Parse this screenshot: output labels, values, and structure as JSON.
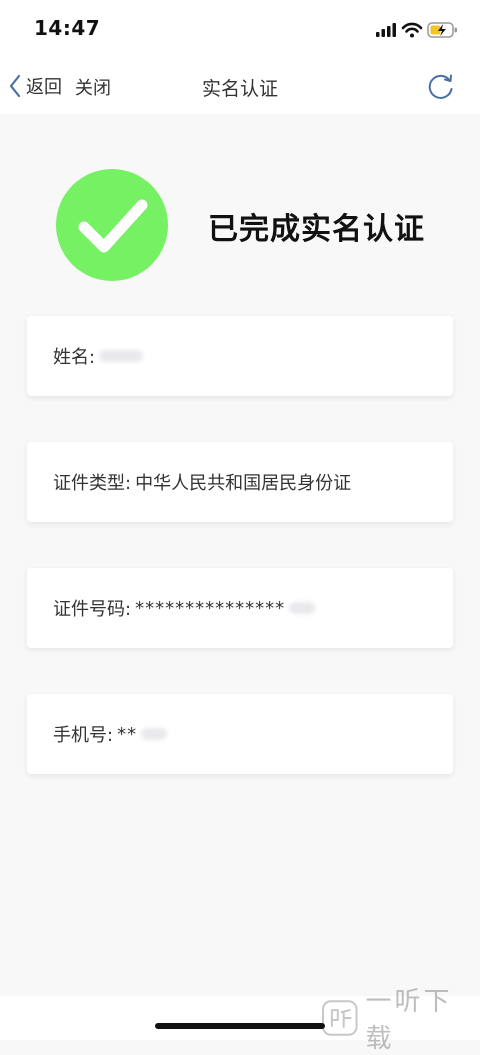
{
  "status_bar": {
    "time": "14:47",
    "icons": [
      "signal-icon",
      "wifi-icon",
      "battery-charging-icon"
    ]
  },
  "nav": {
    "back_label": "返回",
    "close_label": "关闭",
    "title": "实名认证",
    "refresh_icon": "refresh-icon"
  },
  "result": {
    "title": "已完成实名认证",
    "icon": "check-icon",
    "badge_color": "#76f163"
  },
  "info": {
    "name_label": "姓名:",
    "id_type_label": "证件类型:",
    "id_type_value": "中华人民共和国居民身份证",
    "id_number_label": "证件号码:",
    "id_number_value": "***************",
    "phone_label": "手机号:",
    "phone_value": "**"
  },
  "watermark": {
    "text": "一听下载"
  }
}
